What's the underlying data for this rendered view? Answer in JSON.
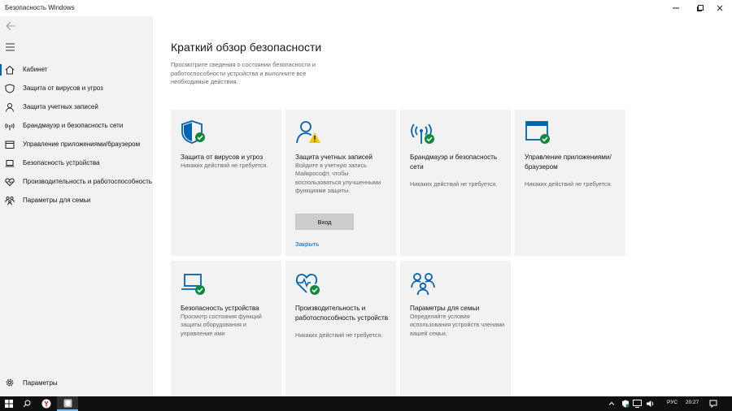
{
  "window": {
    "title": "Безопасность Windows",
    "controls": [
      "minimize-icon",
      "maximize-icon",
      "close-icon"
    ]
  },
  "colors": {
    "accent": "#0063b1",
    "ok": "#10893e",
    "warn": "#f7c600",
    "card_bg": "#f2f2f2"
  },
  "sidebar": {
    "items": [
      {
        "label": "Кабинет",
        "icon": "home-icon",
        "active": true
      },
      {
        "label": "Защита от вирусов и угроз",
        "icon": "shield-icon"
      },
      {
        "label": "Защита учетных записей",
        "icon": "person-icon"
      },
      {
        "label": "Брандмауэр и безопасность сети",
        "icon": "wifi-antenna-icon"
      },
      {
        "label": "Управление приложениями/браузером",
        "icon": "browser-window-icon"
      },
      {
        "label": "Безопасность устройства",
        "icon": "laptop-icon"
      },
      {
        "label": "Производительность и работоспособность",
        "icon": "heart-icon"
      },
      {
        "label": "Параметры для семьи",
        "icon": "family-icon"
      }
    ],
    "settings_label": "Параметры"
  },
  "main": {
    "title": "Краткий обзор безопасности",
    "description": "Просмотрите сведения о состоянии безопасности и работоспособности устройства и выполните все необходимые действия.",
    "cards": [
      {
        "title": "Защита от вирусов и угроз",
        "desc": "Никаких действий не требуется.",
        "icon": "shield-check-icon"
      },
      {
        "title": "Защита учетных записей",
        "desc": "Войдите в учетную запись Майкрософт, чтобы воспользоваться улучшенными функциями защиты.",
        "icon": "person-warning-icon",
        "button": "Вход",
        "link": "Закрыть"
      },
      {
        "title": "Брандмауэр и безопасность сети",
        "desc": "Никаких действий не требуется.",
        "icon": "antenna-check-icon"
      },
      {
        "title": "Управление приложениями/ браузером",
        "desc": "Никаких действий не требуется.",
        "icon": "browser-check-icon"
      },
      {
        "title": "Безопасность устройства",
        "desc": "Просмотр состояния функций защиты оборудования и управление ими",
        "icon": "laptop-check-icon"
      },
      {
        "title": "Производительность и работоспособность устройств",
        "desc": "Никаких действий не требуется.",
        "icon": "heart-check-icon"
      },
      {
        "title": "Параметры для семьи",
        "desc": "Определяйте условия использования устройств членами вашей семьи.",
        "icon": "family-icon"
      }
    ]
  },
  "taskbar": {
    "language": "РУС",
    "time": "20:27"
  }
}
